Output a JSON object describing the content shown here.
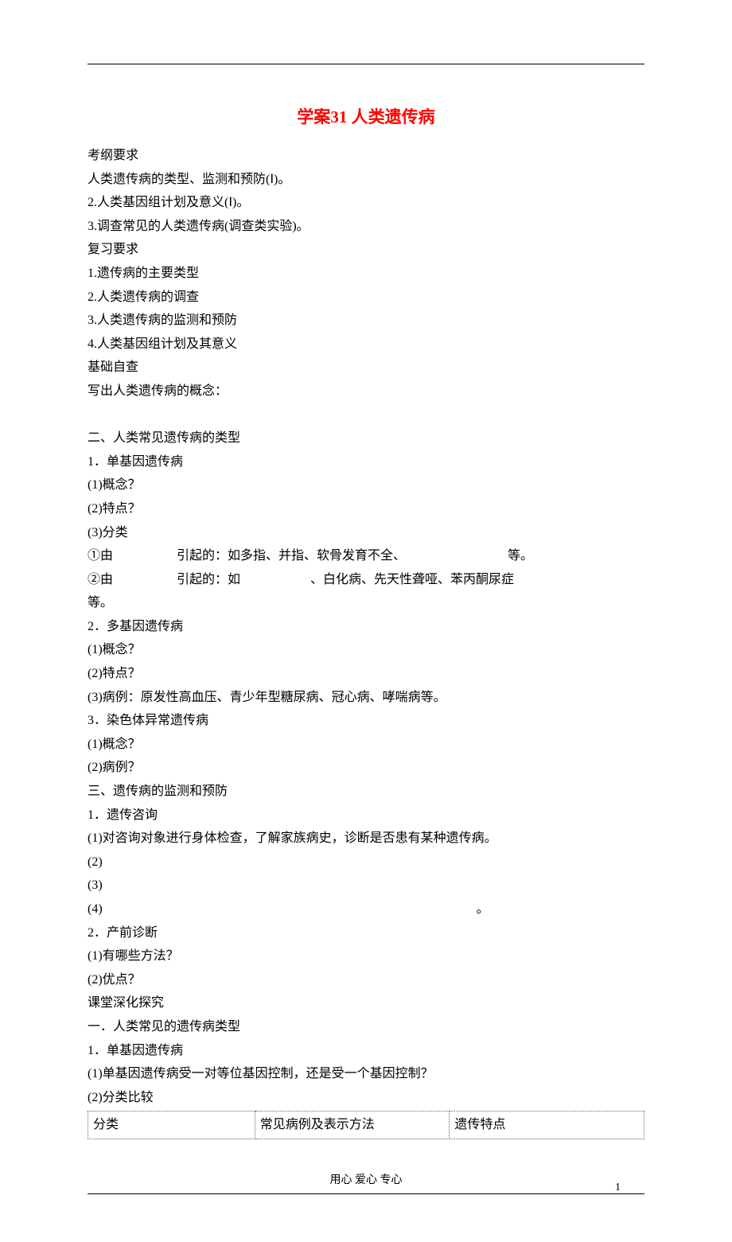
{
  "title": "学案31 人类遗传病",
  "sections": {
    "kgyq": {
      "heading": "考纲要求",
      "items": [
        "人类遗传病的类型、监测和预防(Ⅰ)。",
        "2.人类基因组计划及意义(Ⅰ)。",
        "3.调查常见的人类遗传病(调查类实验)。"
      ]
    },
    "fxyq": {
      "heading": "复习要求",
      "items": [
        "1.遗传病的主要类型",
        "2.人类遗传病的调查",
        "3.人类遗传病的监测和预防",
        "4.人类基因组计划及其意义"
      ]
    },
    "jczc": {
      "heading": "基础自查",
      "line": "写出人类遗传病的概念："
    },
    "sec2": {
      "heading": "二、人类常见遗传病的类型",
      "s1": {
        "title": "1．单基因遗传病",
        "q1": "(1)概念？",
        "q2": "(2)特点？",
        "q3": "(3)分类",
        "c1a": "①由",
        "c1b": "引起的：如多指、并指、软骨发育不全、",
        "c1c": "等。",
        "c2a": "②由",
        "c2b": "引起的：如",
        "c2c": "、白化病、先天性聋哑、苯丙酮尿症",
        "c2d": "等。"
      },
      "s2": {
        "title": "2．多基因遗传病",
        "q1": "(1)概念？",
        "q2": "(2)特点？",
        "q3": "(3)病例：原发性高血压、青少年型糖尿病、冠心病、哮喘病等。"
      },
      "s3": {
        "title": "3．染色体异常遗传病",
        "q1": "(1)概念？",
        "q2": "(2)病例？"
      }
    },
    "sec3": {
      "heading": "三、遗传病的监测和预防",
      "s1": {
        "title": "1．遗传咨询",
        "q1": "(1)对咨询对象进行身体检查，了解家族病史，诊断是否患有某种遗传病。",
        "q2": "(2)",
        "q3": "(3)",
        "q4a": "(4)",
        "q4b": "。"
      },
      "s2": {
        "title": "2．产前诊断",
        "q1": "(1)有哪些方法？",
        "q2": "(2)优点？"
      }
    },
    "ktsh": {
      "heading": "课堂深化探究",
      "t1": "一．人类常见的遗传病类型",
      "s1": {
        "title": "1．单基因遗传病",
        "q1": "(1)单基因遗传病受一对等位基因控制，还是受一个基因控制？",
        "q2": "(2)分类比较"
      }
    }
  },
  "table": {
    "h1": "分类",
    "h2": "常见病例及表示方法",
    "h3": "遗传特点"
  },
  "footer": "用心 爱心 专心",
  "page_number": "1"
}
